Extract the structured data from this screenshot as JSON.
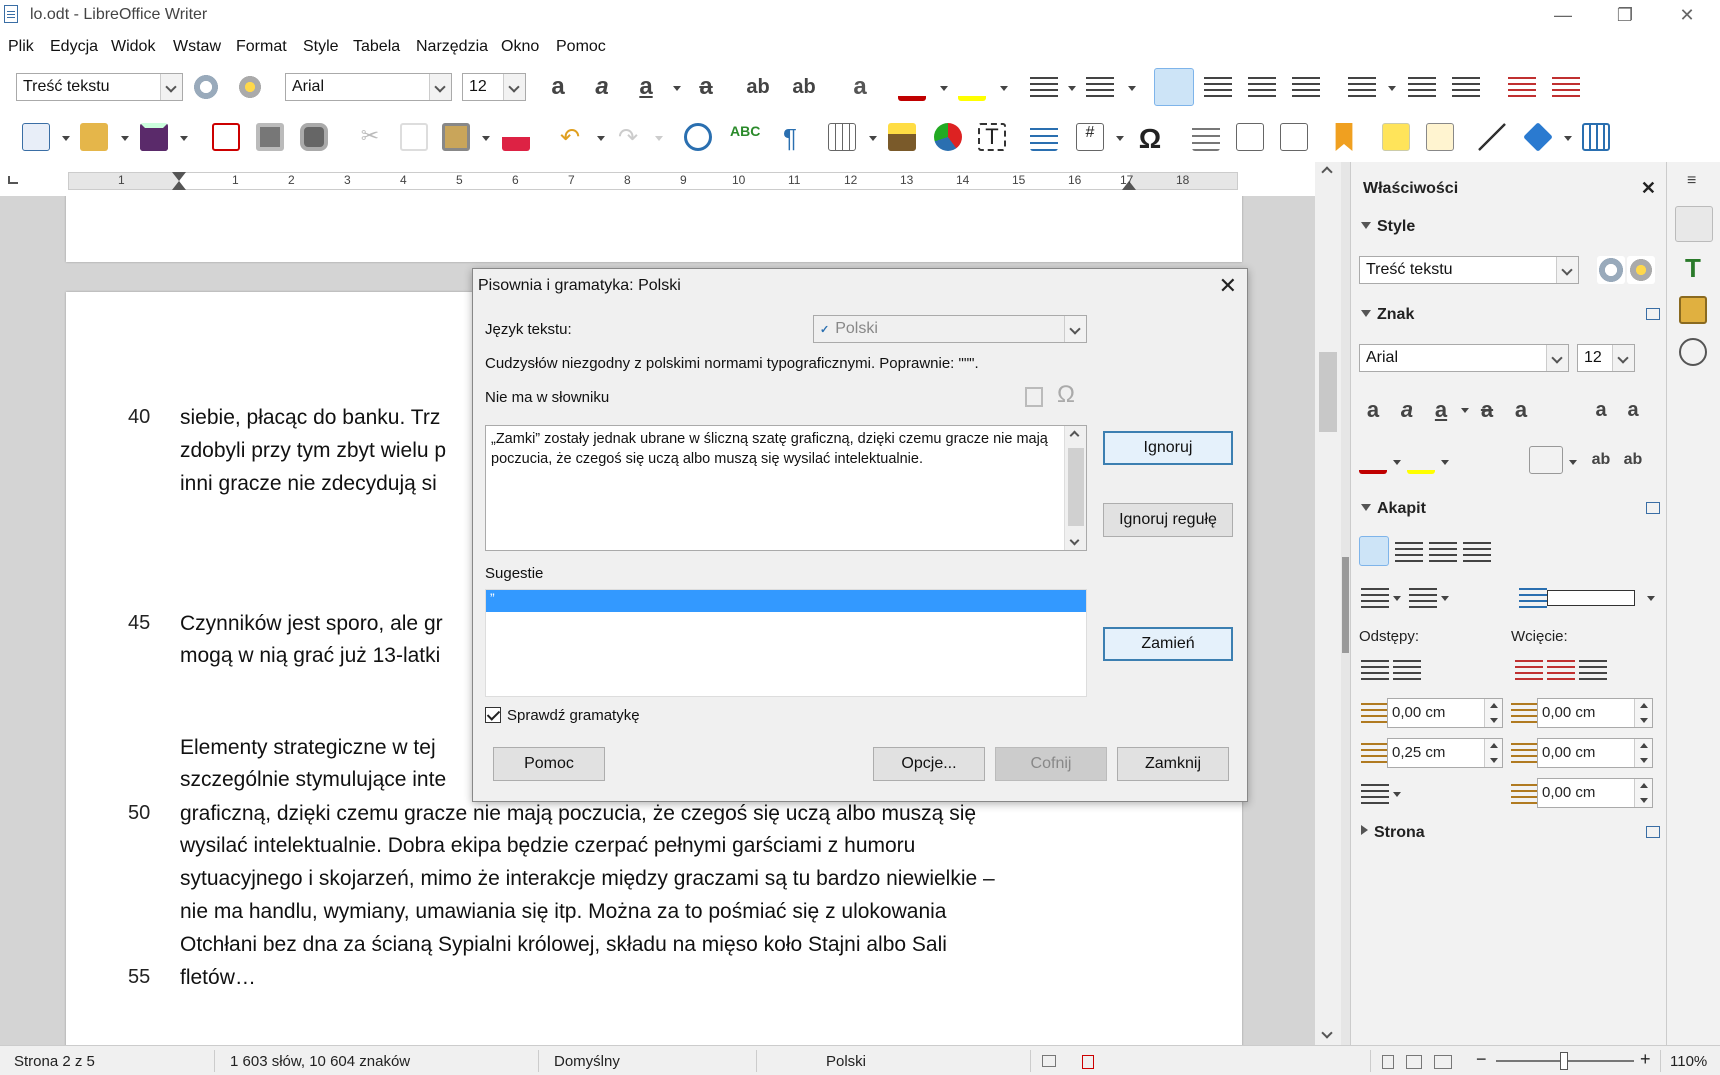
{
  "window": {
    "title": "lo.odt - LibreOffice Writer",
    "min": "—",
    "restore": "❐",
    "close": "✕"
  },
  "menu": [
    "Plik",
    "Edycja",
    "Widok",
    "Wstaw",
    "Format",
    "Style",
    "Tabela",
    "Narzędzia",
    "Okno",
    "Pomoc"
  ],
  "toolbar": {
    "para_style": "Treść tekstu",
    "font_name": "Arial",
    "font_size": "12"
  },
  "ruler": {
    "numbers": [
      "1",
      "1",
      "2",
      "3",
      "4",
      "5",
      "6",
      "7",
      "8",
      "9",
      "10",
      "11",
      "12",
      "13",
      "14",
      "15",
      "16",
      "17",
      "18"
    ]
  },
  "document": {
    "lines": [
      {
        "num": "40",
        "text": "siebie, płacąc do banku. Trz"
      },
      {
        "num": "",
        "text": "zdobyli przy tym zbyt wielu p"
      },
      {
        "num": "",
        "text": "inni gracze nie zdecydują si"
      },
      {
        "num": "45",
        "text": "Czynników jest sporo, ale gr"
      },
      {
        "num": "",
        "text": "mogą w nią grać już 13-latki"
      },
      {
        "num": "",
        "text": "Elementy strategiczne w tej"
      },
      {
        "num": "",
        "text": "szczególnie stymulujące inte"
      },
      {
        "num": "50",
        "text": "graficzną, dzięki czemu gracze nie mają poczucia, że czegoś się uczą albo muszą się"
      },
      {
        "num": "",
        "text": "wysilać intelektualnie. Dobra ekipa będzie czerpać pełnymi garściami z humoru"
      },
      {
        "num": "",
        "text": "sytuacyjnego i skojarzeń, mimo że interakcje między graczami są tu bardzo niewielkie –"
      },
      {
        "num": "",
        "text": "nie ma handlu, wymiany, umawiania się itp. Można za to pośmiać się z ulokowania"
      },
      {
        "num": "",
        "text": "Otchłani bez dna za ścianą Sypialni królowej, składu na mięso koło Stajni albo Sali"
      },
      {
        "num": "55",
        "text": "fletów…"
      }
    ]
  },
  "dialog": {
    "title": "Pisownia i gramatyka: Polski",
    "language_label": "Język tekstu:",
    "language_value": "Polski",
    "message": "Cudzysłów niezgodny z polskimi normami typograficznymi. Poprawnie: \"\"\".",
    "not_in_dict_label": "Nie ma w słowniku",
    "sentence": "„Zamki” zostały jednak ubrane w śliczną szatę graficzną, dzięki czemu gracze nie mają poczucia, że czegoś się uczą albo muszą się wysilać intelektualnie.",
    "suggestions_label": "Sugestie",
    "suggestion_selected": "”",
    "check_grammar_label": "Sprawdź gramatykę",
    "btn_ignore": "Ignoruj",
    "btn_ignore_rule": "Ignoruj regułę",
    "btn_replace": "Zamień",
    "btn_help": "Pomoc",
    "btn_options": "Opcje...",
    "btn_undo": "Cofnij",
    "btn_close": "Zamknij"
  },
  "sidebar": {
    "title": "Właściwości",
    "style_section": "Style",
    "style_value": "Treść tekstu",
    "char_section": "Znak",
    "font_name": "Arial",
    "font_size": "12",
    "para_section": "Akapit",
    "spacing_label": "Odstępy:",
    "indent_label": "Wcięcie:",
    "above": "0,00 cm",
    "below": "0,25 cm",
    "indent_before": "0,00 cm",
    "indent_after": "0,00 cm",
    "indent_first": "0,00 cm",
    "page_section": "Strona"
  },
  "status": {
    "page": "Strona 2 z 5",
    "words": "1 603 słów, 10 604 znaków",
    "page_style": "Domyślny",
    "language": "Polski",
    "zoom": "110%"
  },
  "colors": {
    "accent": "#3399ff",
    "font_color": "#c00000",
    "highlight": "#ffff00"
  }
}
